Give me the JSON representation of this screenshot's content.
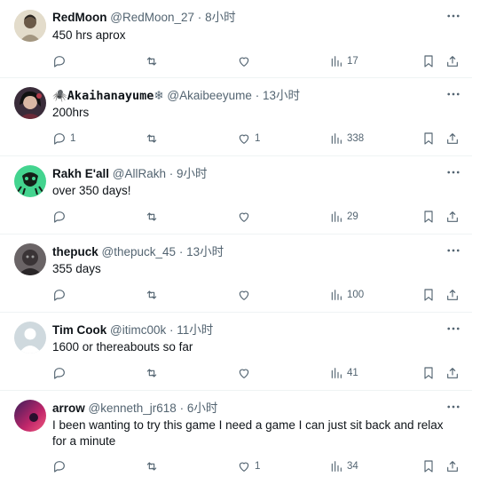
{
  "replies": [
    {
      "name": "RedMoon",
      "handle": "@RedMoon_27",
      "time": "8小时",
      "text": "450 hrs aprox",
      "reply_count": "",
      "like_count": "",
      "view_count": "17",
      "avatar_color": "#c9bfa8"
    },
    {
      "name": "🕷️Akaihanayume",
      "name_suffix": "❄",
      "handle": "@Akaibeeyume",
      "time": "13小时",
      "text": "200hrs",
      "reply_count": "1",
      "like_count": "1",
      "view_count": "338",
      "avatar_color": "#2a2230"
    },
    {
      "name": "Rakh E'all",
      "handle": "@AllRakh",
      "time": "9小时",
      "text": "over 350 days!",
      "reply_count": "",
      "like_count": "",
      "view_count": "29",
      "avatar_color": "#3ecf8e"
    },
    {
      "name": "thepuck",
      "handle": "@thepuck_45",
      "time": "13小时",
      "text": "355 days",
      "reply_count": "",
      "like_count": "",
      "view_count": "100",
      "avatar_color": "#4a4648"
    },
    {
      "name": "Tim Cook",
      "handle": "@itimc00k",
      "time": "11小时",
      "text": "1600 or thereabouts so far",
      "reply_count": "",
      "like_count": "",
      "view_count": "41",
      "avatar_color": "#cfd9de"
    },
    {
      "name": "arrow",
      "handle": "@kenneth_jr618",
      "time": "6小时",
      "text": "I been wanting to try this game I need a game I can just sit back and relax for a minute",
      "reply_count": "",
      "like_count": "1",
      "view_count": "34",
      "avatar_color": "#7a1f4a"
    }
  ],
  "separator": "·",
  "colors": {
    "text": "#0f1419",
    "secondary": "#536471",
    "border": "#eff3f4"
  }
}
